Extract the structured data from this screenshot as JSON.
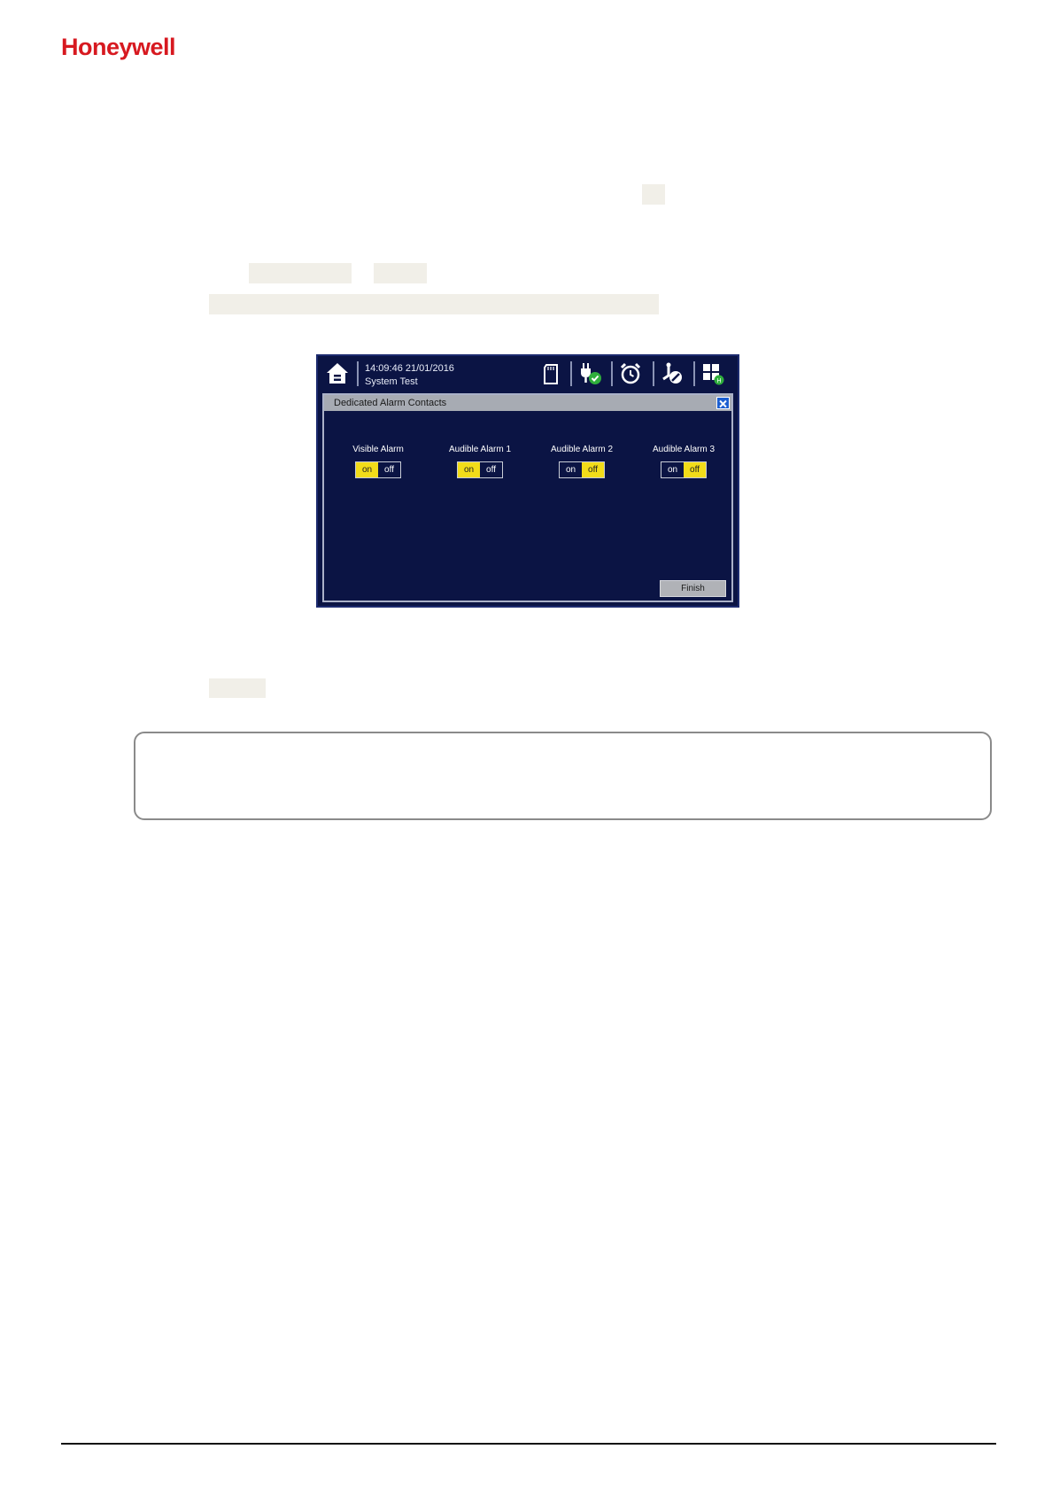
{
  "brand": {
    "logo_text": "Honeywell",
    "color": "#d71920"
  },
  "device_screen": {
    "clock": "14:09:46  21/01/2016",
    "status_text": "System Test",
    "toolbar_icons": [
      "home-icon",
      "sd-card-icon",
      "power-ok-icon",
      "alarm-clock-icon",
      "inhibit-icon",
      "grid-menu-icon"
    ],
    "dialog": {
      "title": "Dedicated Alarm Contacts",
      "alarms": [
        {
          "label": "Visible Alarm",
          "on_label": "on",
          "off_label": "off",
          "state": "on"
        },
        {
          "label": "Audible Alarm 1",
          "on_label": "on",
          "off_label": "off",
          "state": "on"
        },
        {
          "label": "Audible Alarm 2",
          "on_label": "on",
          "off_label": "off",
          "state": "off"
        },
        {
          "label": "Audible Alarm 3",
          "on_label": "on",
          "off_label": "off",
          "state": "off"
        }
      ],
      "finish_label": "Finish"
    },
    "colors": {
      "background": "#0b1444",
      "toggle_active": "#f2dc19",
      "title_bar": "#a7abb3",
      "close_button": "#1c5fd1"
    }
  }
}
